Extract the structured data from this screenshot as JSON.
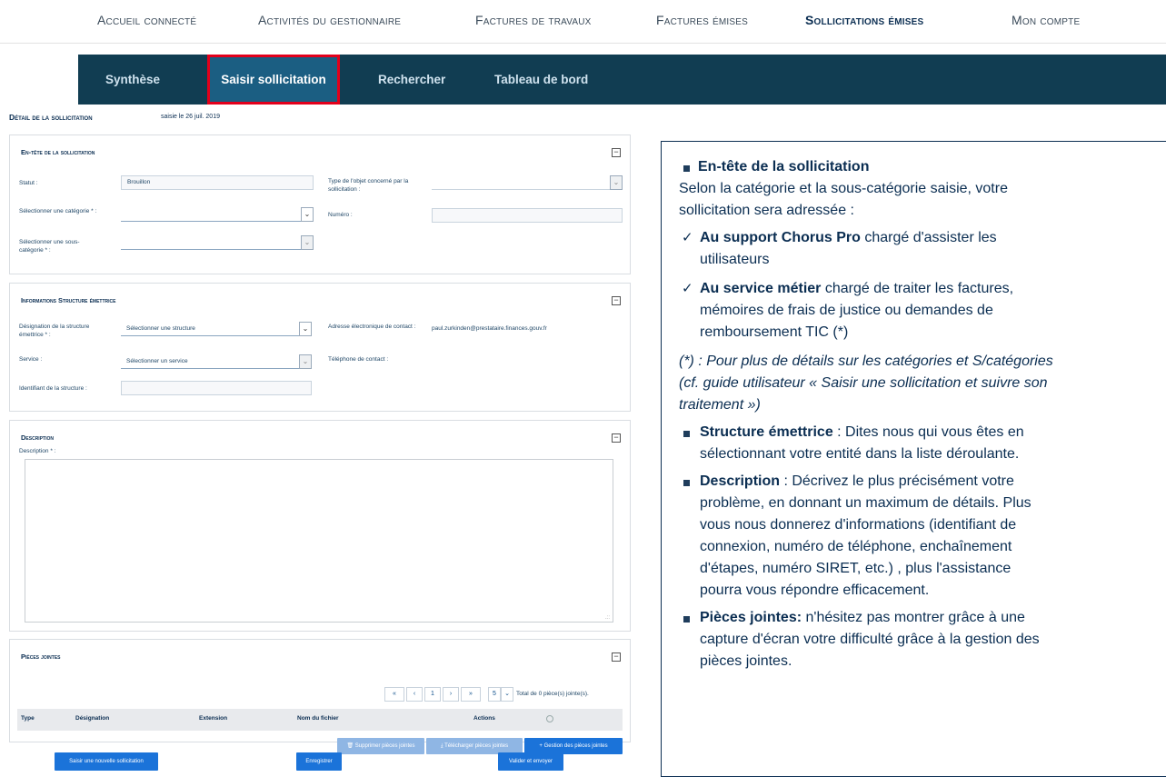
{
  "topnav": {
    "items": [
      "Accueil connecté",
      "Activités du gestionnaire",
      "Factures de travaux",
      "Factures émises",
      "Sollicitations émises",
      "Mon compte"
    ]
  },
  "subnav": {
    "items": [
      "Synthèse",
      "Saisir sollicitation",
      "Rechercher",
      "Tableau de bord"
    ]
  },
  "detail": {
    "title": "Détail de la sollicitation",
    "date": "saisie le 26 juil. 2019"
  },
  "entete": {
    "title": "En-tête de la sollicitation",
    "statut_label": "Statut :",
    "statut_value": "Brouillon",
    "categorie_label": "Sélectionner une catégorie * :",
    "souscat_label": "Sélectionner une sous-catégorie * :",
    "type_label": "Type de l'objet concerné par la sollicitation :",
    "numero_label": "Numéro :"
  },
  "structure": {
    "title": "Informations Structure émettrice",
    "designation_label": "Désignation de la structure émettrice * :",
    "designation_value": "Sélectionner une structure",
    "service_label": "Service :",
    "service_value": "Sélectionner un service",
    "identifiant_label": "Identifiant de la structure :",
    "email_label": "Adresse électronique de contact :",
    "email_value": "paul.zurkinden@prestataire.finances.gouv.fr",
    "tel_label": "Téléphone de contact :"
  },
  "description": {
    "title": "Description",
    "label": "Description * :"
  },
  "pieces": {
    "title": "Pièces jointes",
    "pager": [
      "«",
      "‹",
      "1",
      "›",
      "»"
    ],
    "page_size": "5",
    "total": "Total de 0 pièce(s) jointe(s).",
    "columns": [
      "Type",
      "Désignation",
      "Extension",
      "Nom du fichier",
      "Actions"
    ],
    "buttons": [
      "Supprimer pièces jointes",
      "Télécharger pièces jointes",
      "Gestion des pièces jointes"
    ]
  },
  "bottom": {
    "new": "Saisir une nouvelle sollicitation",
    "save": "Enregistrer",
    "submit": "Valider et envoyer"
  },
  "info": {
    "l1": "En-tête de la sollicitation",
    "l2": "Selon la catégorie et la sous-catégorie saisie, votre",
    "l3": "sollicitation sera adressée :",
    "l4b": "Au support Chorus Pro",
    "l4": " chargé d'assister les",
    "l5": "utilisateurs",
    "l6b": "Au service métier",
    "l6": " chargé de traiter les factures,",
    "l7": "mémoires de frais de justice ou demandes de",
    "l8": "remboursement TIC (*)",
    "l9": "(*) : Pour plus de détails sur les catégories et S/catégories",
    "l10": "(cf. guide utilisateur « Saisir une sollicitation et suivre son",
    "l11": "traitement »)",
    "l12b": "Structure émettrice",
    "l12": " : Dites nous qui vous êtes en",
    "l13": "sélectionnant votre entité dans la liste déroulante.",
    "l14b": "Description",
    "l14": " : Décrivez  le plus précisément votre",
    "l15": "problème, en donnant un maximum de détails. Plus",
    "l16": "vous nous donnerez d'informations (identifiant de",
    "l17": "connexion, numéro de téléphone, enchaînement",
    "l18": "d'étapes, numéro SIRET, etc.) , plus l'assistance",
    "l19": "pourra vous répondre efficacement.",
    "l20b": "Pièces jointes:",
    "l20": " n'hésitez pas montrer grâce à une",
    "l21": "capture d'écran votre difficulté grâce à la gestion des",
    "l22": "pièces jointes."
  }
}
